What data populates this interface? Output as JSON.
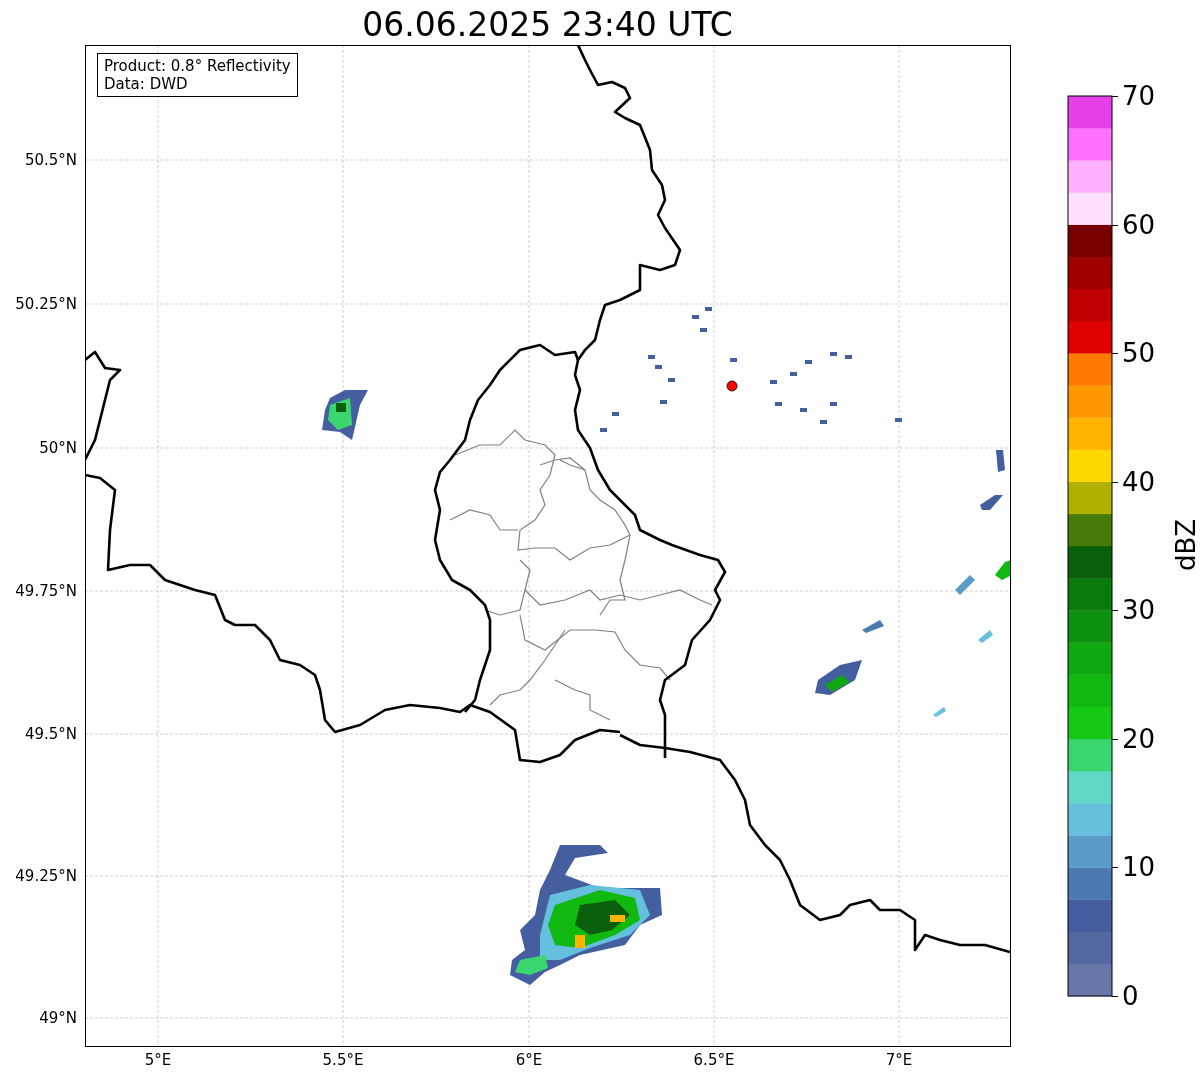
{
  "title": "06.06.2025 23:40 UTC",
  "info_box": [
    "Product: 0.8° Reflectivity",
    "Data: DWD"
  ],
  "lat_labels": [
    "50.5°N",
    "50.25°N",
    "50°N",
    "49.75°N",
    "49.5°N",
    "49.25°N",
    "49°N"
  ],
  "lon_labels": [
    "5°E",
    "5.5°E",
    "6°E",
    "6.5°E",
    "7°E"
  ],
  "colorbar": {
    "label": "dBZ",
    "ticks": [
      "70",
      "60",
      "50",
      "40",
      "30",
      "20",
      "10",
      "0"
    ],
    "bins": [
      {
        "color": "#6877a8"
      },
      {
        "color": "#5468a0"
      },
      {
        "color": "#445ea0"
      },
      {
        "color": "#4a7ab0"
      },
      {
        "color": "#5a9cc8"
      },
      {
        "color": "#64c0dc"
      },
      {
        "color": "#60d8c8"
      },
      {
        "color": "#3cd670"
      },
      {
        "color": "#14c814"
      },
      {
        "color": "#10b810"
      },
      {
        "color": "#10a810"
      },
      {
        "color": "#0c9010"
      },
      {
        "color": "#0a7a0a"
      },
      {
        "color": "#0a600a"
      },
      {
        "color": "#487a0a"
      },
      {
        "color": "#b0b000"
      },
      {
        "color": "#ffd800"
      },
      {
        "color": "#ffb400"
      },
      {
        "color": "#ff9800"
      },
      {
        "color": "#ff7800"
      },
      {
        "color": "#e00000"
      },
      {
        "color": "#c00000"
      },
      {
        "color": "#a00000"
      },
      {
        "color": "#780000"
      },
      {
        "color": "#ffe0ff"
      },
      {
        "color": "#ffb0ff"
      },
      {
        "color": "#ff70ff"
      },
      {
        "color": "#e840e8"
      }
    ]
  }
}
